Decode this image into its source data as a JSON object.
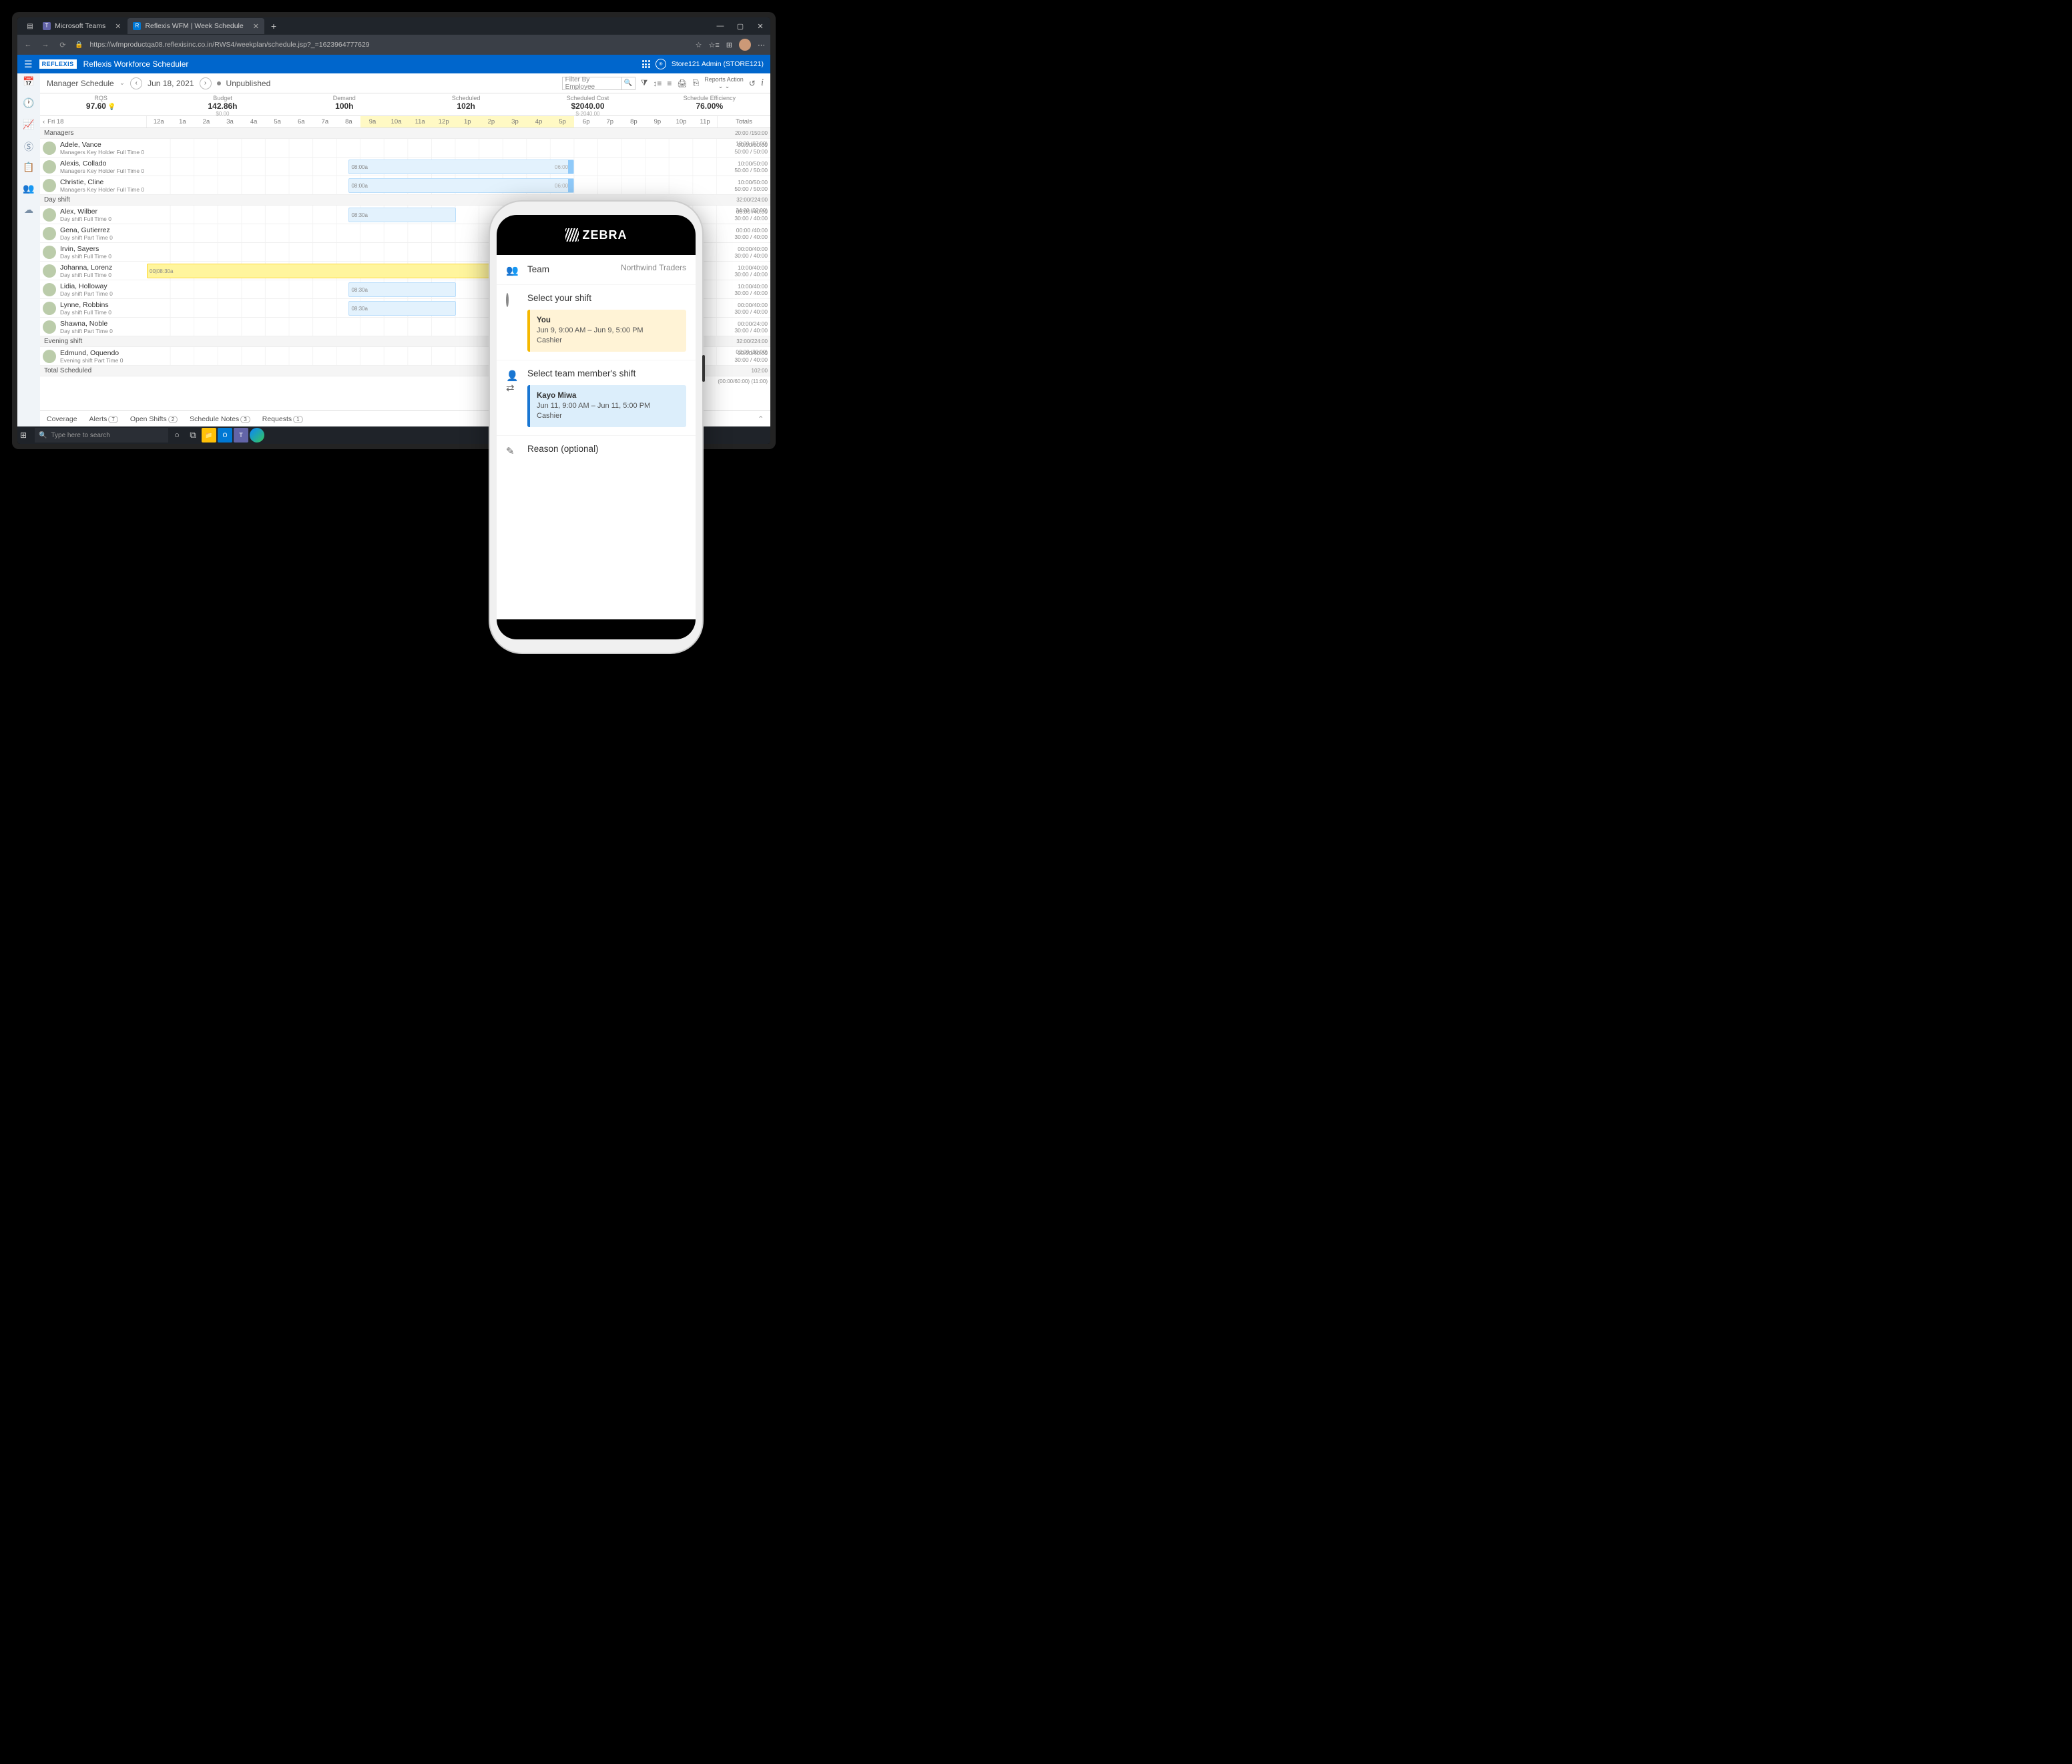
{
  "browser": {
    "tab1": "Microsoft Teams",
    "tab2": "Reflexis WFM | Week Schedule",
    "url": "https://wfmproductqa08.reflexisinc.co.in/RWS4/weekplan/schedule.jsp?_=1623964777629"
  },
  "header": {
    "logo": "REFLEXIS",
    "app_name": "Reflexis Workforce Scheduler",
    "user": "Store121 Admin (STORE121)"
  },
  "toolbar": {
    "page_title": "Manager Schedule",
    "date": "Jun 18, 2021",
    "status": "Unpublished",
    "filter_placeholder": "Filter By Employee",
    "report_label": "Reports",
    "action_label": "Action"
  },
  "kpi": [
    {
      "label": "RQS",
      "value": "97.60",
      "sub": ""
    },
    {
      "label": "Budget",
      "value": "142.86h",
      "sub": "$0.00"
    },
    {
      "label": "Demand",
      "value": "100h",
      "sub": ""
    },
    {
      "label": "Scheduled",
      "value": "102h",
      "sub": ""
    },
    {
      "label": "Scheduled Cost",
      "value": "$2040.00",
      "sub": "$-2040.00"
    },
    {
      "label": "Schedule Efficiency",
      "value": "76.00%",
      "sub": ""
    }
  ],
  "day_label": "Fri 18",
  "hours": [
    "12a",
    "1a",
    "2a",
    "3a",
    "4a",
    "5a",
    "6a",
    "7a",
    "8a",
    "9a",
    "10a",
    "11a",
    "12p",
    "1p",
    "2p",
    "3p",
    "4p",
    "5p",
    "6p",
    "7p",
    "8p",
    "9p",
    "10p",
    "11p"
  ],
  "totals_label": "Totals",
  "sections": [
    {
      "name": "Managers",
      "totals": [
        "20:00 /150:00",
        "18:00 (07:00)"
      ],
      "employees": [
        {
          "name": "Adele, Vance",
          "meta": "Managers Key Holder Full Time 0",
          "bar": null,
          "totals": [
            "00:00/50:00",
            "50:00 / 50:00"
          ]
        },
        {
          "name": "Alexis, Collado",
          "meta": "Managers Key Holder Full Time 0",
          "bar": {
            "start": 8.5,
            "end": 18,
            "label_l": "08:00a",
            "label_r": "06:00p"
          },
          "totals": [
            "10:00/50:00",
            "50:00 / 50:00"
          ]
        },
        {
          "name": "Christie, Cline",
          "meta": "Managers Key Holder Full Time 0",
          "bar": {
            "start": 8.5,
            "end": 18,
            "label_l": "08:00a",
            "label_r": "06:00p"
          },
          "totals": [
            "10:00/50:00",
            "50:00 / 50:00"
          ]
        }
      ]
    },
    {
      "name": "Day shift",
      "totals": [
        "32:00/224:00",
        "34:00 (02:00)"
      ],
      "employees": [
        {
          "name": "Alex, Wilber",
          "meta": "Day shift Full Time 0",
          "bar": {
            "start": 8.5,
            "end": 13,
            "label_l": "08:30a",
            "no_handle": true
          },
          "totals": [
            "08:00 /40:00",
            "30:00 / 40:00"
          ]
        },
        {
          "name": "Gena, Gutierrez",
          "meta": "Day shift Part Time 0",
          "bar": null,
          "totals": [
            "00:00 /40:00",
            "30:00 / 40:00"
          ]
        },
        {
          "name": "Irvin, Sayers",
          "meta": "Day shift Full Time 0",
          "bar": null,
          "totals": [
            "00:00/40:00",
            "30:00 / 40:00"
          ]
        },
        {
          "name": "Johanna, Lorenz",
          "meta": "Day shift Full Time 0",
          "bar": {
            "start": 0,
            "end": 16,
            "yellow": true,
            "label_l": "00|08:30a"
          },
          "totals": [
            "10:00/40:00",
            "30:00 / 40:00"
          ]
        },
        {
          "name": "Lidia, Holloway",
          "meta": "Day shift Part Time 0",
          "bar": {
            "start": 8.5,
            "end": 13,
            "label_l": "08:30a",
            "no_handle": true
          },
          "totals": [
            "10:00/40:00",
            "30:00 / 40:00"
          ]
        },
        {
          "name": "Lynne, Robbins",
          "meta": "Day shift Full Time 0",
          "bar": {
            "start": 8.5,
            "end": 13,
            "label_l": "08:30a",
            "no_handle": true
          },
          "totals": [
            "00:00/40:00",
            "30:00 / 40:00"
          ]
        },
        {
          "name": "Shawna, Noble",
          "meta": "Day shift Part Time 0",
          "bar": null,
          "totals": [
            "00:00/24:00",
            "30:00 / 40:00"
          ]
        }
      ]
    },
    {
      "name": "Evening shift",
      "totals": [
        "32:00/224:00",
        "02:00 (30:00)"
      ],
      "employees": [
        {
          "name": "Edmund, Oquendo",
          "meta": "Evening shift Part Time 0",
          "bar": null,
          "totals": [
            "00:00/40:00",
            "30:00 / 40:00"
          ]
        }
      ]
    }
  ],
  "total_scheduled_label": "Total Scheduled",
  "total_scheduled_totals": [
    "102:00",
    "(00:00/60:00) (11:00)"
  ],
  "bottom_tabs": [
    {
      "label": "Coverage",
      "count": ""
    },
    {
      "label": "Alerts",
      "count": "7"
    },
    {
      "label": "Open Shifts",
      "count": "2"
    },
    {
      "label": "Schedule Notes",
      "count": "3"
    },
    {
      "label": "Requests",
      "count": "1"
    }
  ],
  "taskbar": {
    "search": "Type here to search"
  },
  "zebra": {
    "brand": "ZEBRA",
    "team_label": "Team",
    "team_name": "Northwind Traders",
    "select_your": "Select your shift",
    "your_card": {
      "name": "You",
      "time": "Jun 9, 9:00 AM – Jun 9, 5:00 PM",
      "role": "Cashier"
    },
    "select_member": "Select team member's shift",
    "member_card": {
      "name": "Kayo Miwa",
      "time": "Jun 11, 9:00 AM – Jun 11, 5:00 PM",
      "role": "Cashier"
    },
    "reason": "Reason (optional)"
  }
}
